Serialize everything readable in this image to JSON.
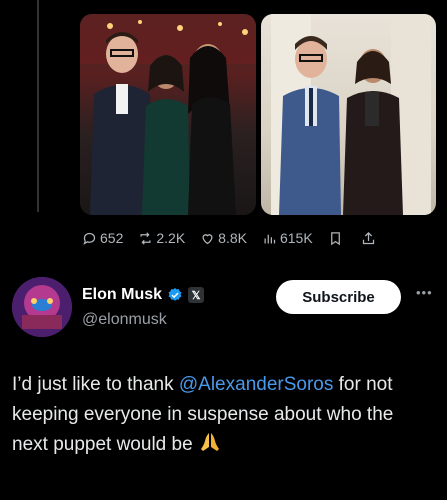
{
  "stats": {
    "replies": "652",
    "reposts": "2.2K",
    "likes": "8.8K",
    "views": "615K"
  },
  "author": {
    "name": "Elon Musk",
    "handle": "@elonmusk",
    "badge_color": "#1d9bf0",
    "subscribe_label": "Subscribe"
  },
  "tweet": {
    "text_before": "I’d just like to thank ",
    "mention": "@AlexanderSoros",
    "text_after": " for not keeping everyone in suspense about who the next puppet would be",
    "emoji": "folded-hands-emoji"
  },
  "colors": {
    "background": "#000000",
    "mention": "#4a99e9",
    "text": "#e7e9ea",
    "muted": "#9aa0a6"
  }
}
